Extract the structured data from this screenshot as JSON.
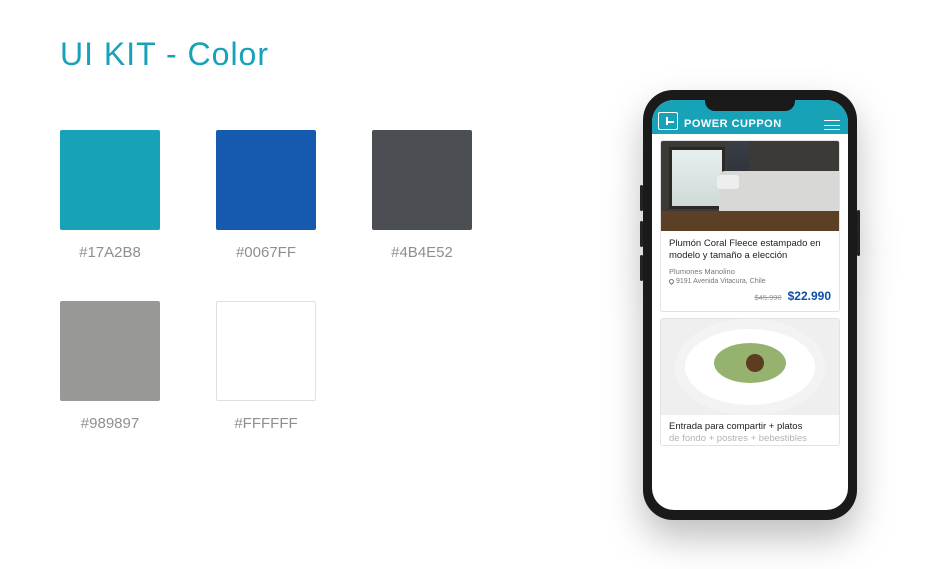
{
  "title": "UI KIT -  Color",
  "colors": {
    "teal": {
      "hex": "#17A2B8"
    },
    "blue": {
      "hex": "#0067FF",
      "swatch": "#165ab0"
    },
    "dark": {
      "hex": "#4B4E52"
    },
    "gray": {
      "hex": "#989897"
    },
    "white": {
      "hex": "#FFFFFF"
    }
  },
  "phone": {
    "brand": "POWER CUPPON",
    "card1": {
      "title": "Plumón Coral Fleece estampado en modelo y tamaño a elección",
      "vendor": "Plumones Manolino",
      "location": "9191 Avenida Vitacura, Chile",
      "price_old": "$45.990",
      "price_new": "$22.990"
    },
    "card2": {
      "title_line": "Entrada para compartir + platos",
      "title_cut": "de fondo + postres + bebestibles"
    }
  }
}
